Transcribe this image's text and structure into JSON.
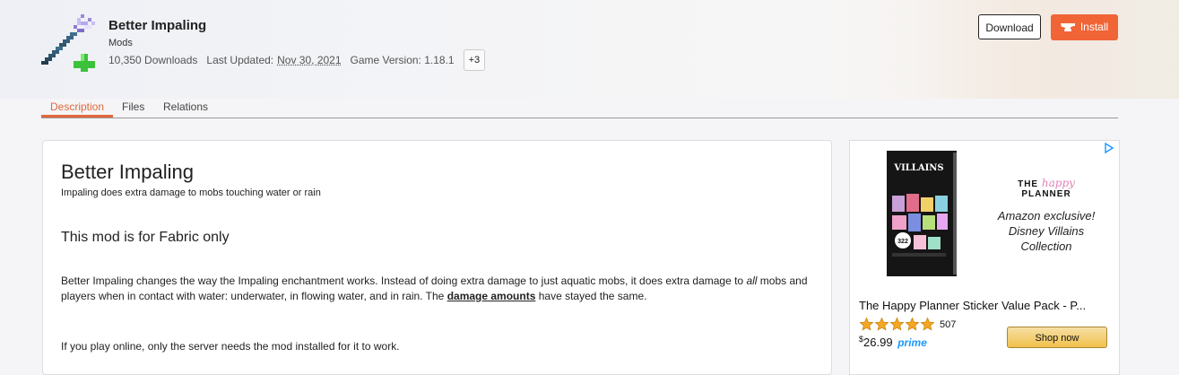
{
  "project": {
    "title": "Better Impaling",
    "category": "Mods",
    "downloads": "10,350 Downloads",
    "last_updated_label": "Last Updated:",
    "last_updated": "Nov 30, 2021",
    "game_version": "Game Version: 1.18.1",
    "more_versions": "+3",
    "logo_icon": "trident-plus-icon"
  },
  "actions": {
    "download": "Download",
    "install": "Install",
    "install_icon": "curseforge-anvil-icon"
  },
  "tabs": [
    {
      "label": "Description",
      "active": true
    },
    {
      "label": "Files",
      "active": false
    },
    {
      "label": "Relations",
      "active": false
    }
  ],
  "description": {
    "heading": "Better Impaling",
    "summary": "Impaling does extra damage to mobs touching water or rain",
    "subheading": "This mod is for Fabric only",
    "para_part1": "Better Impaling changes the way the Impaling enchantment works. Instead of doing extra damage to just aquatic mobs, it does extra damage to ",
    "para_em": "all",
    "para_part2": " mobs and players when in contact with water: underwater, in flowing water, and in rain. The ",
    "para_link": "damage amounts",
    "para_part3": " have stayed the same.",
    "para2": "If you play online, only the server needs the mod installed for it to work."
  },
  "ad": {
    "brand_pre": "THE",
    "brand_script": "happy",
    "brand_post": "PLANNER",
    "tagline_lines": [
      "Amazon exclusive!",
      "Disney Villains",
      "Collection"
    ],
    "product_cover_text": "VILLAINS",
    "product_badge": "322",
    "title": "The Happy Planner Sticker Value Pack - P...",
    "rating": 5,
    "review_count": "507",
    "price_symbol": "$",
    "price": "26.99",
    "prime_label": "prime",
    "shop_button": "Shop now"
  },
  "colors": {
    "accent": "#f16436",
    "tab_active": "#e2683c",
    "prime_blue": "#1a98ff",
    "star": "#f5a623"
  }
}
